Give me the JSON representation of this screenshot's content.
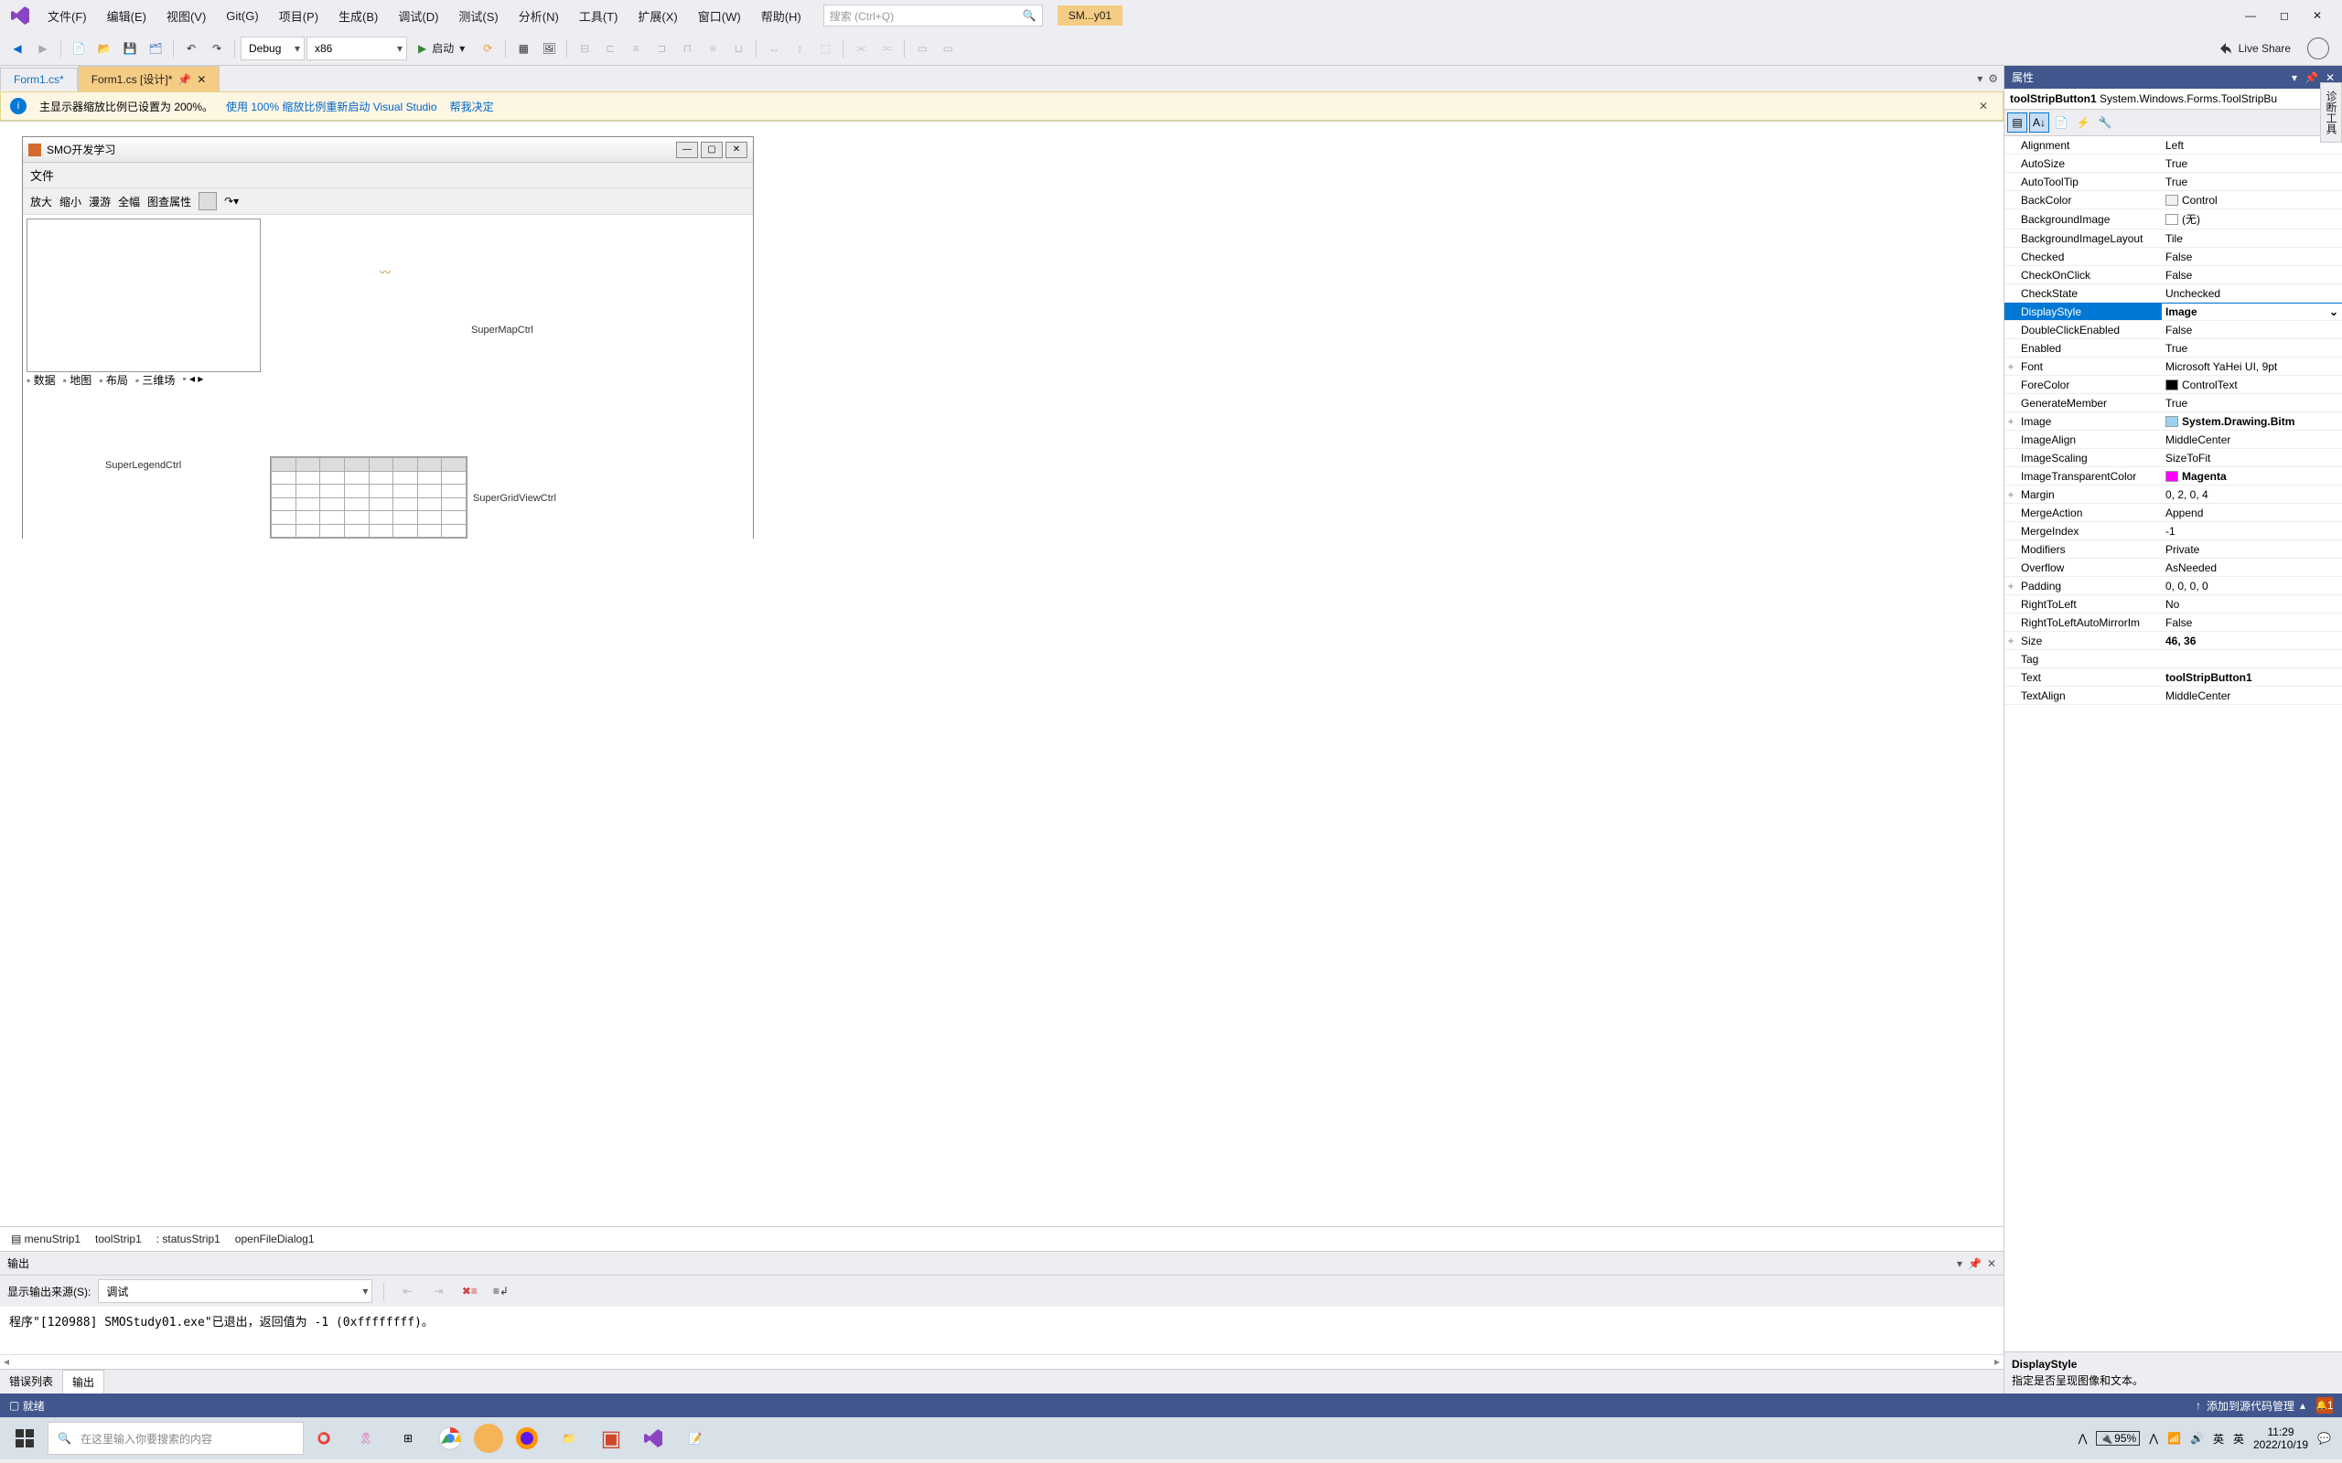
{
  "menubar": {
    "items": [
      "文件(F)",
      "编辑(E)",
      "视图(V)",
      "Git(G)",
      "项目(P)",
      "生成(B)",
      "调试(D)",
      "测试(S)",
      "分析(N)",
      "工具(T)",
      "扩展(X)",
      "窗口(W)",
      "帮助(H)"
    ],
    "search_placeholder": "搜索 (Ctrl+Q)",
    "solution": "SM...y01"
  },
  "toolbar": {
    "config": "Debug",
    "platform": "x86",
    "start": "启动",
    "liveshare": "Live Share"
  },
  "tabs": {
    "items": [
      "Form1.cs*",
      "Form1.cs [设计]*"
    ],
    "active": 1
  },
  "infobar": {
    "text": "主显示器缩放比例已设置为 200%。",
    "link1": "使用 100% 缩放比例重新启动 Visual Studio",
    "link2": "帮我决定"
  },
  "form": {
    "title": "SMO开发学习",
    "menu": "文件",
    "toolbar_items": [
      "放大",
      "缩小",
      "漫游",
      "全幅",
      "图查属性"
    ],
    "labels": {
      "map": "SuperMapCtrl",
      "legend": "SuperLegendCtrl",
      "grid": "SuperGridViewCtrl"
    },
    "tabs": [
      "数据",
      "地图",
      "布局",
      "三维场"
    ]
  },
  "tray": [
    "menuStrip1",
    "toolStrip1",
    "statusStrip1",
    "openFileDialog1"
  ],
  "output": {
    "title": "输出",
    "src_label": "显示输出来源(S):",
    "src_value": "调试",
    "line": "程序\"[120988] SMOStudy01.exe\"已退出，返回值为 -1 (0xffffffff)。",
    "tabs": [
      "错误列表",
      "输出"
    ],
    "active_tab": 1
  },
  "props": {
    "title": "属性",
    "object": "toolStripButton1",
    "object_type": "System.Windows.Forms.ToolStripBu",
    "rows": [
      {
        "n": "Alignment",
        "v": "Left"
      },
      {
        "n": "AutoSize",
        "v": "True"
      },
      {
        "n": "AutoToolTip",
        "v": "True"
      },
      {
        "n": "BackColor",
        "v": "Control",
        "sw": "#f0f0f0"
      },
      {
        "n": "BackgroundImage",
        "v": "(无)",
        "sw": "#fff"
      },
      {
        "n": "BackgroundImageLayout",
        "v": "Tile"
      },
      {
        "n": "Checked",
        "v": "False"
      },
      {
        "n": "CheckOnClick",
        "v": "False"
      },
      {
        "n": "CheckState",
        "v": "Unchecked"
      },
      {
        "n": "DisplayStyle",
        "v": "Image",
        "sel": true,
        "bold": true,
        "dd": true
      },
      {
        "n": "DoubleClickEnabled",
        "v": "False"
      },
      {
        "n": "Enabled",
        "v": "True"
      },
      {
        "n": "Font",
        "v": "Microsoft YaHei UI, 9pt",
        "exp": "+"
      },
      {
        "n": "ForeColor",
        "v": "ControlText",
        "sw": "#000"
      },
      {
        "n": "GenerateMember",
        "v": "True"
      },
      {
        "n": "Image",
        "v": "System.Drawing.Bitm",
        "exp": "+",
        "bold": true,
        "sw": "#9cd1f4"
      },
      {
        "n": "ImageAlign",
        "v": "MiddleCenter"
      },
      {
        "n": "ImageScaling",
        "v": "SizeToFit"
      },
      {
        "n": "ImageTransparentColor",
        "v": "Magenta",
        "sw": "#ff00ff",
        "bold": true
      },
      {
        "n": "Margin",
        "v": "0, 2, 0, 4",
        "exp": "+"
      },
      {
        "n": "MergeAction",
        "v": "Append"
      },
      {
        "n": "MergeIndex",
        "v": "-1"
      },
      {
        "n": "Modifiers",
        "v": "Private"
      },
      {
        "n": "Overflow",
        "v": "AsNeeded"
      },
      {
        "n": "Padding",
        "v": "0, 0, 0, 0",
        "exp": "+"
      },
      {
        "n": "RightToLeft",
        "v": "No"
      },
      {
        "n": "RightToLeftAutoMirrorIm",
        "v": "False"
      },
      {
        "n": "Size",
        "v": "46, 36",
        "exp": "+",
        "bold": true
      },
      {
        "n": "Tag",
        "v": ""
      },
      {
        "n": "Text",
        "v": "toolStripButton1",
        "bold": true
      },
      {
        "n": "TextAlign",
        "v": "MiddleCenter"
      }
    ],
    "desc_title": "DisplayStyle",
    "desc_text": "指定是否呈现图像和文本。"
  },
  "sidetab": "诊断工具",
  "statusbar": {
    "ready": "就绪",
    "source": "添加到源代码管理",
    "notif": "1"
  },
  "taskbar": {
    "search": "在这里输入你要搜索的内容",
    "battery": "95%",
    "ime1": "英",
    "ime2": "英",
    "time": "11:29",
    "date": "2022/10/19"
  }
}
